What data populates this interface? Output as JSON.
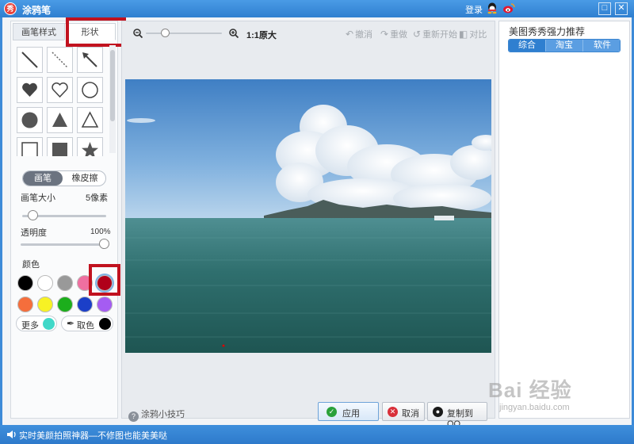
{
  "window": {
    "title": "涂鸦笔",
    "app_icon_glyph": "秀",
    "login_label": "登录",
    "restore_glyph": "□",
    "close_glyph": "✕"
  },
  "left_panel": {
    "tabs": [
      {
        "label": "画笔样式",
        "active": false
      },
      {
        "label": "形状",
        "active": true
      }
    ],
    "shapes": [
      "line",
      "dashed-line",
      "arrow",
      "heart-filled",
      "heart-outline",
      "circle-outline",
      "circle-filled",
      "triangle-filled",
      "triangle-outline",
      "square-outline",
      "square-filled",
      "star-filled"
    ],
    "tool_toggle": {
      "pen_label": "画笔",
      "eraser_label": "橡皮擦",
      "active": "pen"
    },
    "brush_size": {
      "label": "画笔大小",
      "value_text": "5像素",
      "level": 0.08
    },
    "opacity": {
      "label": "透明度",
      "value_text": "100%",
      "level": 1.0
    },
    "color_label": "颜色",
    "colors_row1": [
      "#000000",
      "#ffffff",
      "#999999",
      "#ef6fa0",
      "#b0001a"
    ],
    "colors_row2": [
      "#f56e3c",
      "#f7f224",
      "#1cae1c",
      "#1b3fc8",
      "#a55cf2"
    ],
    "selected_color": "#b0001a",
    "more_label": "更多",
    "more_color": "#40d8c8",
    "pick_label": "取色",
    "pick_color": "#000000"
  },
  "center": {
    "zoom_label": "1:1原大",
    "zoom_level": 0.22,
    "actions": [
      {
        "label": "撤消",
        "icon": "undo-icon"
      },
      {
        "label": "重做",
        "icon": "redo-icon"
      },
      {
        "label": "重新开始",
        "icon": "restart-icon"
      },
      {
        "label": "对比",
        "icon": "compare-icon"
      }
    ],
    "tip_label": "涂鸦小技巧",
    "apply_label": "应用",
    "cancel_label": "取消",
    "copy_qq_label": "复制到QQ"
  },
  "right_panel": {
    "title": "美图秀秀强力推荐",
    "tabs": [
      {
        "label": "综合",
        "active": true
      },
      {
        "label": "淘宝",
        "active": false
      },
      {
        "label": "软件",
        "active": false
      }
    ]
  },
  "status": {
    "text": "实时美颜拍照神器—不修图也能美美哒"
  },
  "watermark": {
    "main": "Bai 经验",
    "sub": "jingyan.baidu.com"
  }
}
